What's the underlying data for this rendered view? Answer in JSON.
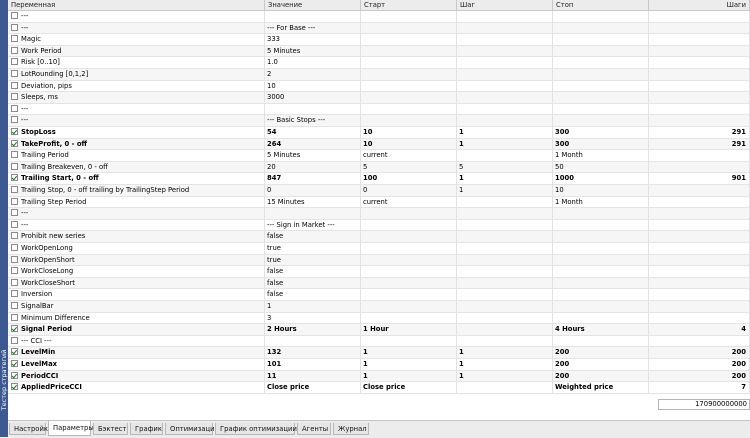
{
  "sidebar_label": "Тестер стратегий",
  "columns": [
    "Переменная",
    "Значение",
    "Старт",
    "Шаг",
    "Стоп",
    "Шаги"
  ],
  "rows": [
    {
      "checked": false,
      "bold": false,
      "name": "---",
      "value": "",
      "start": "",
      "step": "",
      "stop": "",
      "steps": ""
    },
    {
      "checked": false,
      "bold": false,
      "name": "---",
      "value": "--- For Base ---",
      "start": "",
      "step": "",
      "stop": "",
      "steps": ""
    },
    {
      "checked": false,
      "bold": false,
      "name": "Magic",
      "value": "333",
      "start": "",
      "step": "",
      "stop": "",
      "steps": ""
    },
    {
      "checked": false,
      "bold": false,
      "name": "Work Period",
      "value": "5 Minutes",
      "start": "",
      "step": "",
      "stop": "",
      "steps": ""
    },
    {
      "checked": false,
      "bold": false,
      "name": "Risk [0..10]",
      "value": "1.0",
      "start": "",
      "step": "",
      "stop": "",
      "steps": ""
    },
    {
      "checked": false,
      "bold": false,
      "name": "LotRounding [0,1,2]",
      "value": "2",
      "start": "",
      "step": "",
      "stop": "",
      "steps": ""
    },
    {
      "checked": false,
      "bold": false,
      "name": "Deviation, pips",
      "value": "10",
      "start": "",
      "step": "",
      "stop": "",
      "steps": ""
    },
    {
      "checked": false,
      "bold": false,
      "name": "Sleeps, ms",
      "value": "3000",
      "start": "",
      "step": "",
      "stop": "",
      "steps": ""
    },
    {
      "checked": false,
      "bold": false,
      "name": "---",
      "value": "",
      "start": "",
      "step": "",
      "stop": "",
      "steps": ""
    },
    {
      "checked": false,
      "bold": false,
      "name": "---",
      "value": "--- Basic Stops ---",
      "start": "",
      "step": "",
      "stop": "",
      "steps": ""
    },
    {
      "checked": true,
      "bold": true,
      "name": "StopLoss",
      "value": "54",
      "start": "10",
      "step": "1",
      "stop": "300",
      "steps": "291"
    },
    {
      "checked": true,
      "bold": true,
      "name": "TakeProfit, 0 - off",
      "value": "264",
      "start": "10",
      "step": "1",
      "stop": "300",
      "steps": "291"
    },
    {
      "checked": false,
      "bold": false,
      "name": "Trailing Period",
      "value": "5 Minutes",
      "start": "current",
      "step": "",
      "stop": "1 Month",
      "steps": ""
    },
    {
      "checked": false,
      "bold": false,
      "name": "Trailing Breakeven, 0 - off",
      "value": "20",
      "start": "5",
      "step": "5",
      "stop": "50",
      "steps": ""
    },
    {
      "checked": true,
      "bold": true,
      "name": "Trailing Start, 0 - off",
      "value": "847",
      "start": "100",
      "step": "1",
      "stop": "1000",
      "steps": "901"
    },
    {
      "checked": false,
      "bold": false,
      "name": "Trailing Stop, 0 - off trailing by TrailingStep Period",
      "value": "0",
      "start": "0",
      "step": "1",
      "stop": "10",
      "steps": ""
    },
    {
      "checked": false,
      "bold": false,
      "name": "Trailing Step Period",
      "value": "15 Minutes",
      "start": "current",
      "step": "",
      "stop": "1 Month",
      "steps": ""
    },
    {
      "checked": false,
      "bold": false,
      "name": "---",
      "value": "",
      "start": "",
      "step": "",
      "stop": "",
      "steps": ""
    },
    {
      "checked": false,
      "bold": false,
      "name": "---",
      "value": "--- Sign in Market ---",
      "start": "",
      "step": "",
      "stop": "",
      "steps": ""
    },
    {
      "checked": false,
      "bold": false,
      "name": "Prohibit new series",
      "value": "false",
      "start": "",
      "step": "",
      "stop": "",
      "steps": ""
    },
    {
      "checked": false,
      "bold": false,
      "name": "WorkOpenLong",
      "value": "true",
      "start": "",
      "step": "",
      "stop": "",
      "steps": ""
    },
    {
      "checked": false,
      "bold": false,
      "name": "WorkOpenShort",
      "value": "true",
      "start": "",
      "step": "",
      "stop": "",
      "steps": ""
    },
    {
      "checked": false,
      "bold": false,
      "name": "WorkCloseLong",
      "value": "false",
      "start": "",
      "step": "",
      "stop": "",
      "steps": ""
    },
    {
      "checked": false,
      "bold": false,
      "name": "WorkCloseShort",
      "value": "false",
      "start": "",
      "step": "",
      "stop": "",
      "steps": ""
    },
    {
      "checked": false,
      "bold": false,
      "name": "Inversion",
      "value": "false",
      "start": "",
      "step": "",
      "stop": "",
      "steps": ""
    },
    {
      "checked": false,
      "bold": false,
      "name": "SignalBar",
      "value": "1",
      "start": "",
      "step": "",
      "stop": "",
      "steps": ""
    },
    {
      "checked": false,
      "bold": false,
      "name": "Minimum Difference",
      "value": "3",
      "start": "",
      "step": "",
      "stop": "",
      "steps": ""
    },
    {
      "checked": true,
      "bold": true,
      "name": "Signal Period",
      "value": "2 Hours",
      "start": "1 Hour",
      "step": "",
      "stop": "4 Hours",
      "steps": "4"
    },
    {
      "checked": false,
      "bold": false,
      "name": "--- CCI ---",
      "value": "",
      "start": "",
      "step": "",
      "stop": "",
      "steps": ""
    },
    {
      "checked": true,
      "bold": true,
      "name": "LevelMin",
      "value": "132",
      "start": "1",
      "step": "1",
      "stop": "200",
      "steps": "200"
    },
    {
      "checked": true,
      "bold": true,
      "name": "LevelMax",
      "value": "101",
      "start": "1",
      "step": "1",
      "stop": "200",
      "steps": "200"
    },
    {
      "checked": true,
      "bold": true,
      "name": "PeriodCCI",
      "value": "11",
      "start": "1",
      "step": "1",
      "stop": "200",
      "steps": "200"
    },
    {
      "checked": true,
      "bold": true,
      "name": "AppliedPriceCCI",
      "value": "Close price",
      "start": "Close price",
      "step": "",
      "stop": "Weighted price",
      "steps": "7"
    }
  ],
  "total_steps": "170900000000",
  "tabs": [
    "Настройки",
    "Параметры",
    "Бэктест",
    "График",
    "Оптимизация",
    "График оптимизации",
    "Агенты",
    "Журнал"
  ],
  "active_tab": "Параметры",
  "colors": {
    "sidebar": "#3c5a91",
    "check": "#1c7a1c"
  }
}
